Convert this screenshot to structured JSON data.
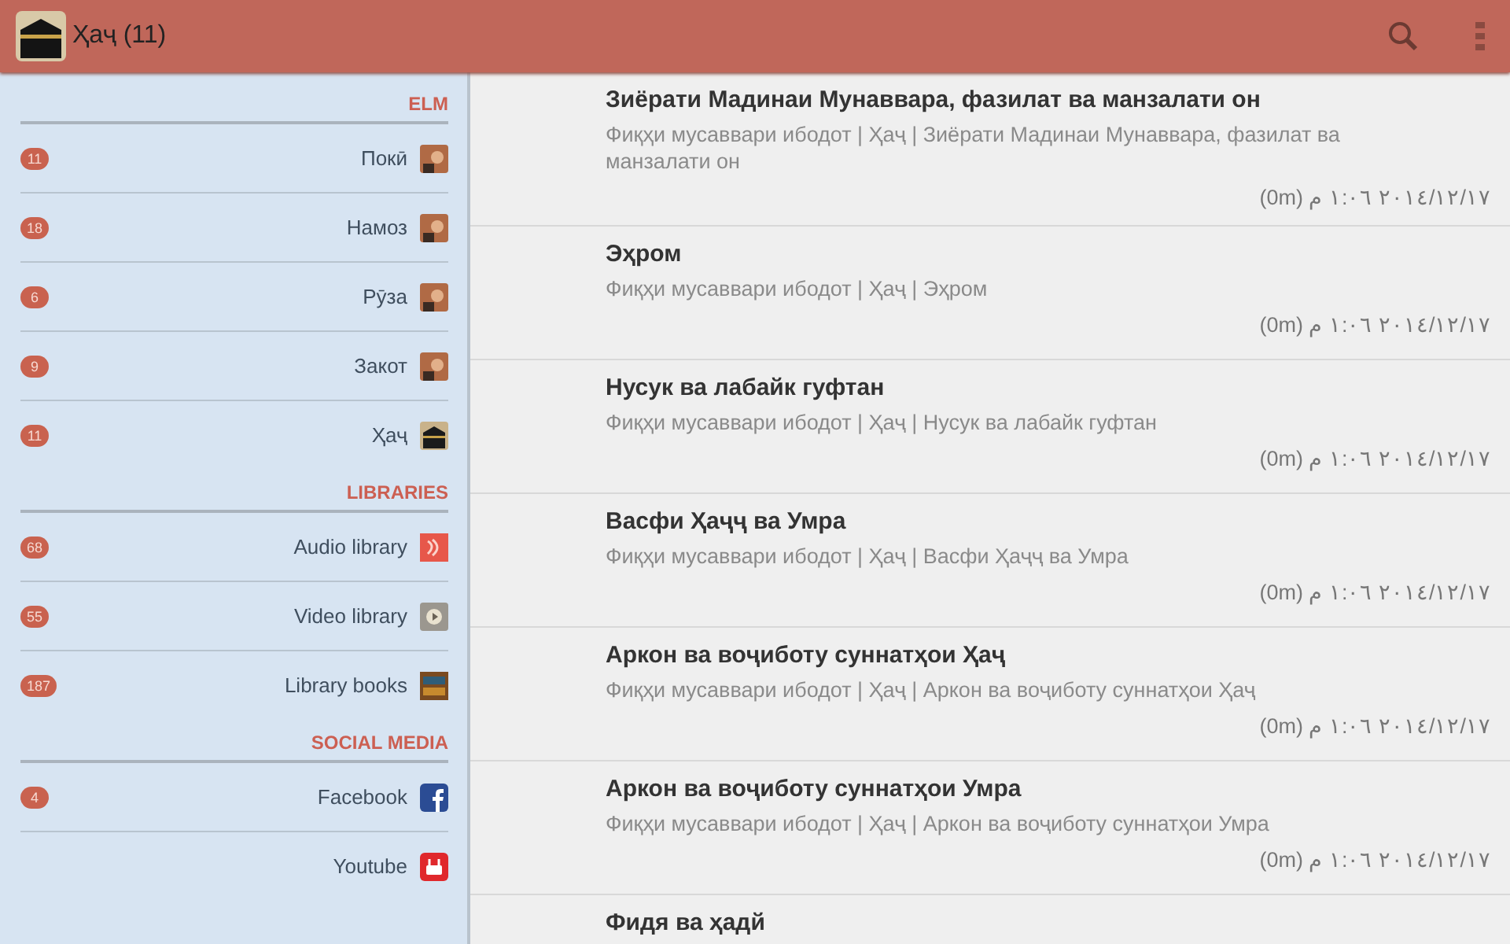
{
  "app_bar": {
    "title": "Ҳаҷ (11)"
  },
  "sidebar": {
    "sections": [
      {
        "title": "ELM",
        "items": [
          {
            "label": "Покӣ",
            "count": "11",
            "kind": "photo"
          },
          {
            "label": "Намоз",
            "count": "18",
            "kind": "photo"
          },
          {
            "label": "Рӯза",
            "count": "6",
            "kind": "photo"
          },
          {
            "label": "Закот",
            "count": "9",
            "kind": "photo"
          },
          {
            "label": "Ҳаҷ",
            "count": "11",
            "kind": "kaaba"
          }
        ]
      },
      {
        "title": "LIBRARIES",
        "items": [
          {
            "label": "Audio library",
            "count": "68",
            "kind": "audio"
          },
          {
            "label": "Video library",
            "count": "55",
            "kind": "video"
          },
          {
            "label": "Library books",
            "count": "187",
            "kind": "books"
          }
        ]
      },
      {
        "title": "SOCIAL MEDIA",
        "items": [
          {
            "label": "Facebook",
            "count": "4",
            "kind": "facebook"
          },
          {
            "label": "Youtube",
            "kind": "youtube"
          }
        ]
      }
    ]
  },
  "articles": [
    {
      "title": "Зиёрати Мадинаи Мунаввара, фазилат ва манзалати он",
      "path": "Фиқҳи мусаввари ибодот | Ҳаҷ | Зиёрати Мадинаи Мунаввара, фазилат ва манзалати он",
      "date": "٢٠١٤/١٢/١٧ ١:٠٦ م (0m)"
    },
    {
      "title": "Эҳром",
      "path": "Фиқҳи мусаввари ибодот | Ҳаҷ | Эҳром",
      "date": "٢٠١٤/١٢/١٧ ١:٠٦ م (0m)"
    },
    {
      "title": "Нусук ва лабайк гуфтан",
      "path": "Фиқҳи мусаввари ибодот | Ҳаҷ | Нусук ва лабайк гуфтан",
      "date": "٢٠١٤/١٢/١٧ ١:٠٦ م (0m)"
    },
    {
      "title": "Васфи Ҳаҷҷ ва Умра",
      "path": "Фиқҳи мусаввари ибодот | Ҳаҷ | Васфи Ҳаҷҷ ва Умра",
      "date": "٢٠١٤/١٢/١٧ ١:٠٦ م (0m)"
    },
    {
      "title": "Аркон ва воҷиботу суннатҳои Ҳаҷ",
      "path": "Фиқҳи мусаввари ибодот | Ҳаҷ | Аркон ва воҷиботу суннатҳои Ҳаҷ",
      "date": "٢٠١٤/١٢/١٧ ١:٠٦ م (0m)"
    },
    {
      "title": "Аркон ва воҷиботу суннатҳои Умра",
      "path": "Фиқҳи мусаввари ибодот | Ҳаҷ | Аркон ва воҷиботу суннатҳои Умра",
      "date": "٢٠١٤/١٢/١٧ ١:٠٦ م (0m)"
    },
    {
      "title": "Фидя ва ҳадй"
    }
  ]
}
